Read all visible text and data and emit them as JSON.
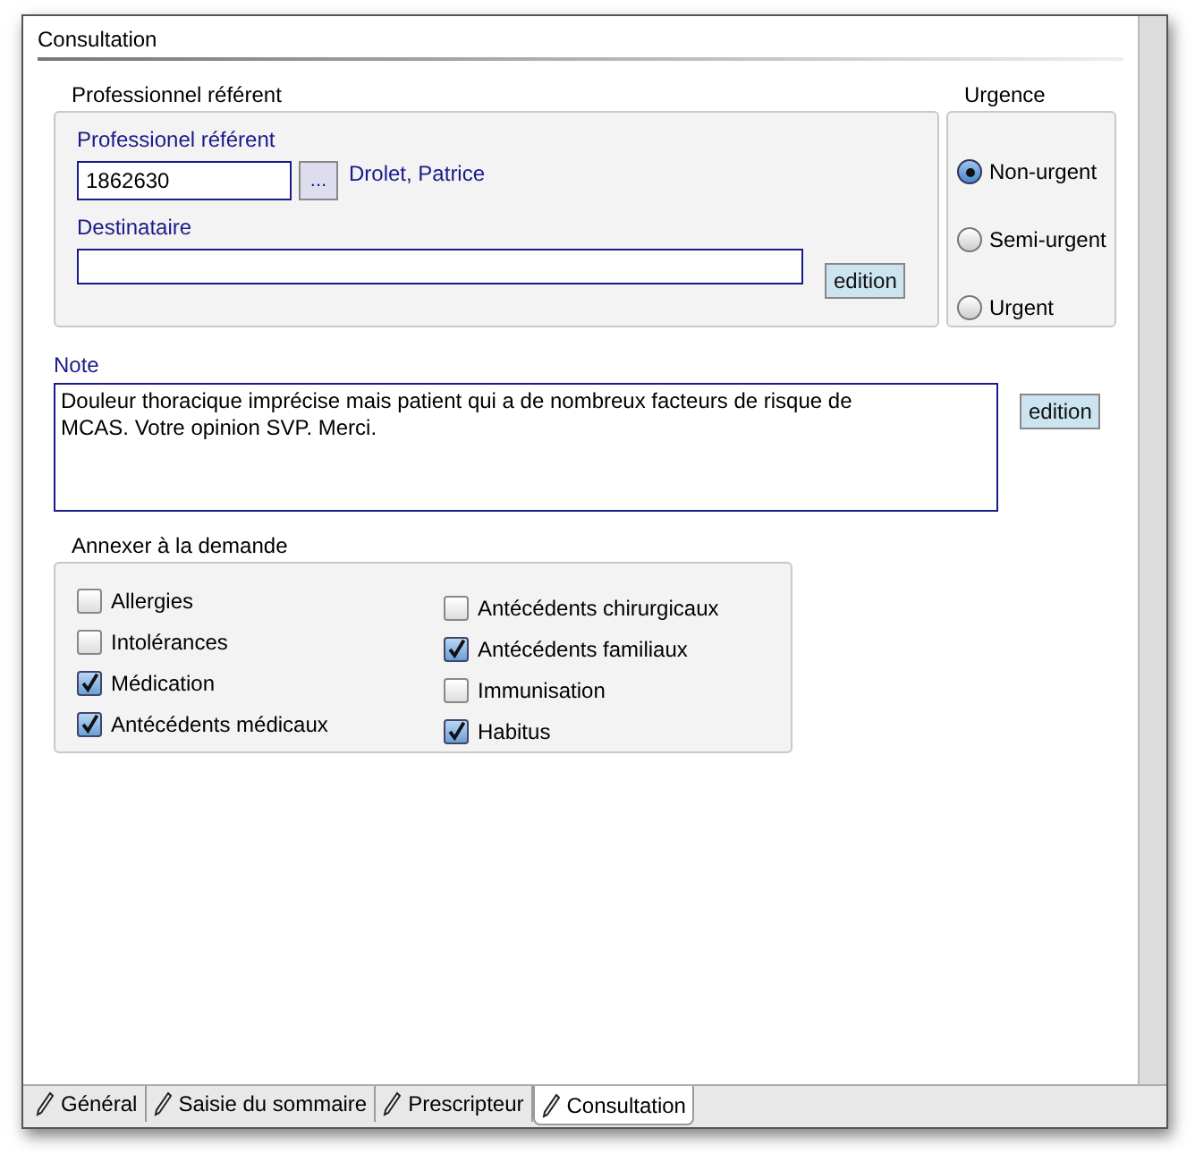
{
  "section_title": "Consultation",
  "referent": {
    "legend": "Professionnel référent",
    "label": "Professionel référent",
    "id_value": "1862630",
    "browse_button": "...",
    "name": "Drolet, Patrice",
    "recipient_label": "Destinataire",
    "edit_button": "edition"
  },
  "urgency": {
    "legend": "Urgence",
    "options": [
      {
        "label": "Non-urgent",
        "selected": true
      },
      {
        "label": "Semi-urgent",
        "selected": false
      },
      {
        "label": "Urgent",
        "selected": false
      }
    ]
  },
  "note": {
    "label": "Note",
    "value": "Douleur thoracique imprécise mais patient qui a de nombreux facteurs de risque de MCAS. Votre opinion SVP. Merci.",
    "edit_button": "edition"
  },
  "attachments": {
    "legend": "Annexer à la demande",
    "columns": [
      [
        {
          "label": "Allergies",
          "checked": false
        },
        {
          "label": "Intolérances",
          "checked": false
        },
        {
          "label": "Médication",
          "checked": true
        },
        {
          "label": "Antécédents médicaux",
          "checked": true
        }
      ],
      [
        {
          "label": "Antécédents chirurgicaux",
          "checked": false
        },
        {
          "label": "Antécédents familiaux",
          "checked": true
        },
        {
          "label": "Immunisation",
          "checked": false
        },
        {
          "label": "Habitus",
          "checked": true
        }
      ]
    ]
  },
  "tabs": [
    {
      "label": "Général",
      "selected": false
    },
    {
      "label": "Saisie du sommaire",
      "selected": false
    },
    {
      "label": "Prescripteur",
      "selected": false
    },
    {
      "label": "Consultation",
      "selected": true
    }
  ]
}
